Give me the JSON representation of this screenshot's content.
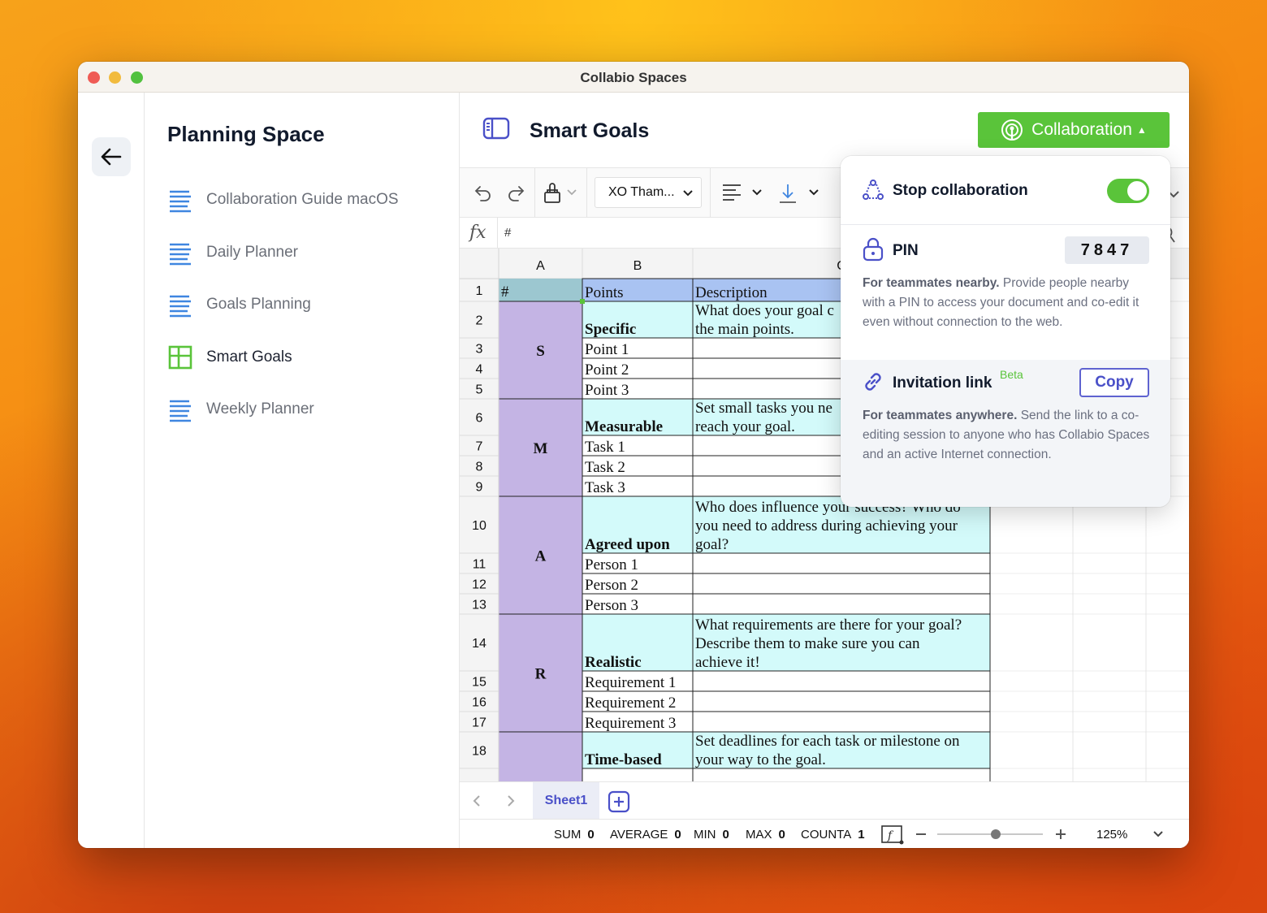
{
  "window": {
    "title": "Collabio Spaces"
  },
  "sidebar": {
    "space_title": "Planning Space",
    "items": [
      {
        "label": "Collaboration Guide macOS",
        "icon": "document-lines-icon",
        "active": false
      },
      {
        "label": "Daily Planner",
        "icon": "document-lines-icon",
        "active": false
      },
      {
        "label": "Goals Planning",
        "icon": "document-lines-icon",
        "active": false
      },
      {
        "label": "Smart Goals",
        "icon": "spreadsheet-icon",
        "active": true
      },
      {
        "label": "Weekly Planner",
        "icon": "document-lines-icon",
        "active": false
      }
    ]
  },
  "document": {
    "title": "Smart Goals",
    "collaboration_button": "Collaboration"
  },
  "toolbar": {
    "font": "XO Tham..."
  },
  "formula_bar": {
    "fx": "fx",
    "value": "#"
  },
  "sheet": {
    "columns": [
      "A",
      "B",
      "C"
    ],
    "rows": [
      {
        "n": "1",
        "b": [
          "Points"
        ],
        "c": [
          "Description"
        ]
      },
      {
        "n": "2",
        "b": [
          "Specific"
        ],
        "c": [
          "What does your goal c",
          "the main points."
        ]
      },
      {
        "n": "3",
        "b": [
          "Point 1"
        ],
        "c": []
      },
      {
        "n": "4",
        "b": [
          "Point 2"
        ],
        "c": []
      },
      {
        "n": "5",
        "b": [
          "Point 3"
        ],
        "c": []
      },
      {
        "n": "6",
        "b": [
          "Measurable"
        ],
        "c": [
          "Set small tasks you ne",
          "reach your goal."
        ]
      },
      {
        "n": "7",
        "b": [
          "Task 1"
        ],
        "c": []
      },
      {
        "n": "8",
        "b": [
          "Task 2"
        ],
        "c": []
      },
      {
        "n": "9",
        "b": [
          "Task 3"
        ],
        "c": []
      },
      {
        "n": "10",
        "b": [
          "Agreed upon"
        ],
        "c": [
          "Who does influence your success? Who do",
          "you need to address during achieving your",
          "goal?"
        ]
      },
      {
        "n": "11",
        "b": [
          "Person 1"
        ],
        "c": []
      },
      {
        "n": "12",
        "b": [
          "Person 2"
        ],
        "c": []
      },
      {
        "n": "13",
        "b": [
          "Person 3"
        ],
        "c": []
      },
      {
        "n": "14",
        "b": [
          "Realistic"
        ],
        "c": [
          "What requirements are there for your goal?",
          "Describe them to make sure you can",
          "achieve it!"
        ]
      },
      {
        "n": "15",
        "b": [
          "Requirement 1"
        ],
        "c": []
      },
      {
        "n": "16",
        "b": [
          "Requirement 2"
        ],
        "c": []
      },
      {
        "n": "17",
        "b": [
          "Requirement 3"
        ],
        "c": []
      },
      {
        "n": "18",
        "b": [
          "Time-based"
        ],
        "c": [
          "Set deadlines for each task or milestone on",
          "your way to the goal."
        ]
      }
    ],
    "a_header": "#",
    "groups": [
      "S",
      "M",
      "A",
      "R"
    ],
    "tab": "Sheet1"
  },
  "status_bar": {
    "items": [
      {
        "label": "SUM",
        "value": "0"
      },
      {
        "label": "AVERAGE",
        "value": "0"
      },
      {
        "label": "MIN",
        "value": "0"
      },
      {
        "label": "MAX",
        "value": "0"
      },
      {
        "label": "COUNTA",
        "value": "1"
      }
    ],
    "zoom": "125%",
    "zoom_level": 0.55
  },
  "popover": {
    "stop_title": "Stop collaboration",
    "stop_enabled": true,
    "pin_title": "PIN",
    "pin_value": "7847",
    "pin_bold": "For teammates nearby.",
    "pin_text": " Provide people nearby with a PIN to access your document and co-edit it even without connection to the web.",
    "link_title": "Invitation link",
    "link_badge": "Beta",
    "copy_label": "Copy",
    "link_bold": "For teammates anywhere.",
    "link_text": " Send the link to a co-editing session to anyone who has Collabio Spaces and an active Internet connection."
  },
  "colors": {
    "accent_green": "#5ac43a",
    "accent_blue": "#3f86e0",
    "accent_indigo": "#4a50c8",
    "header_blue": "#a9c3f2",
    "header_teal": "#9cc7d0",
    "cell_cyan": "#d3fafa",
    "group_purple": "#c4b4e4"
  }
}
